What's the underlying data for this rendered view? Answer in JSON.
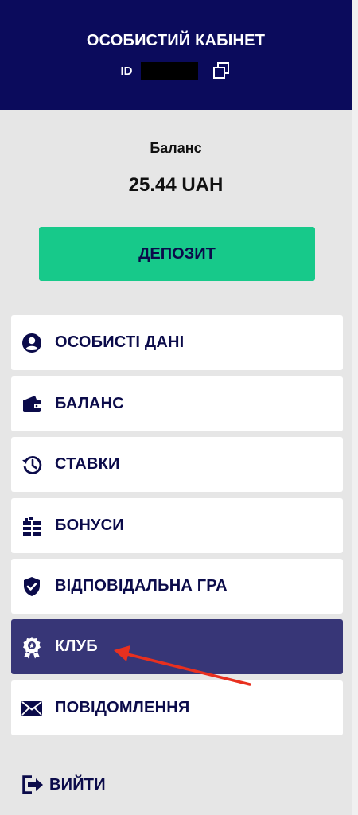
{
  "header": {
    "title": "ОСОБИСТИЙ КАБІНЕТ",
    "id_label": "ID"
  },
  "balance": {
    "label": "Баланс",
    "value": "25.44 UAH"
  },
  "deposit_button": "ДЕПОЗИТ",
  "menu": {
    "items": [
      {
        "label": "ОСОБИСТІ ДАНІ",
        "icon": "user-icon"
      },
      {
        "label": "БАЛАНС",
        "icon": "wallet-icon"
      },
      {
        "label": "СТАВКИ",
        "icon": "history-icon"
      },
      {
        "label": "БОНУСИ",
        "icon": "gift-icon"
      },
      {
        "label": "ВІДПОВІДАЛЬНА ГРА",
        "icon": "shield-check-icon"
      },
      {
        "label": "КЛУБ",
        "icon": "award-icon",
        "active": true
      },
      {
        "label": "ПОВІДОМЛЕННЯ",
        "icon": "envelope-icon"
      }
    ]
  },
  "logout": {
    "label": "ВИЙТИ",
    "icon": "logout-icon"
  },
  "colors": {
    "header_bg": "#0b0b5c",
    "accent_green": "#17c98a",
    "active_item_bg": "#373677",
    "text_dark": "#0b0b4a",
    "annotation_red": "#e8301f"
  }
}
